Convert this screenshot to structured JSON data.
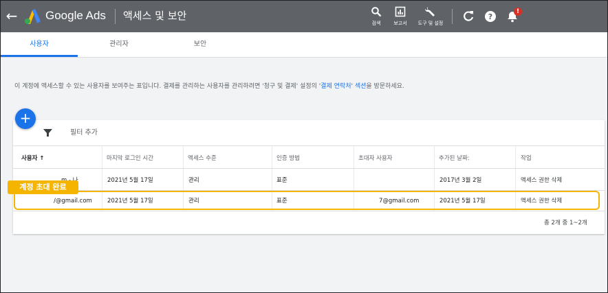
{
  "header": {
    "back_icon": "arrow-left-icon",
    "brand": "Google Ads",
    "title": "액세스 및 보안",
    "tools": [
      {
        "label": "검색",
        "icon": "search-icon"
      },
      {
        "label": "보고서",
        "icon": "bar-chart-icon"
      },
      {
        "label": "도구 및 설정",
        "icon": "wrench-icon"
      }
    ],
    "right_icons": [
      "refresh-icon",
      "help-icon",
      "bell-icon"
    ],
    "notification_badge": "!"
  },
  "tabs": [
    "사용자",
    "관리자",
    "보안"
  ],
  "active_tab": "사용자",
  "description": {
    "before": "이 계정에 액세스할 수 있는 사용자를 보여주는 표입니다. 결제를 관리하는 사용자를 관리하려면 '청구 및 결제' 설정의 '",
    "link": "결제 연락처' 섹션",
    "after": "을 방문하세요."
  },
  "fab": "+",
  "filter": {
    "label": "필터 추가"
  },
  "table": {
    "columns": [
      "사용자 ↑",
      "마지막 로그인 시간",
      "액세스 수준",
      "인증 방법",
      "초대자 사용자",
      "추가된 날짜:",
      "작업"
    ],
    "rows": [
      {
        "user": "m - 나",
        "last_login": "2021년 5월 17일",
        "access": "관리",
        "auth": "표준",
        "inviter": "",
        "added": "2017년 3월 2일",
        "action": "액세스 권한 삭제"
      },
      {
        "user": "/@gmail.com",
        "last_login": "2021년 5월 17일",
        "access": "관리",
        "auth": "표준",
        "inviter": "7@gmail.com",
        "added": "2021년 5월 17일",
        "action": "액세스 권한 삭제"
      }
    ]
  },
  "badge": "계정 초대 완료",
  "pagination": "총 2개 중 1~2개",
  "colors": {
    "topbar": "#5f6368",
    "accent": "#1a73e8",
    "highlight": "#f4b400"
  }
}
